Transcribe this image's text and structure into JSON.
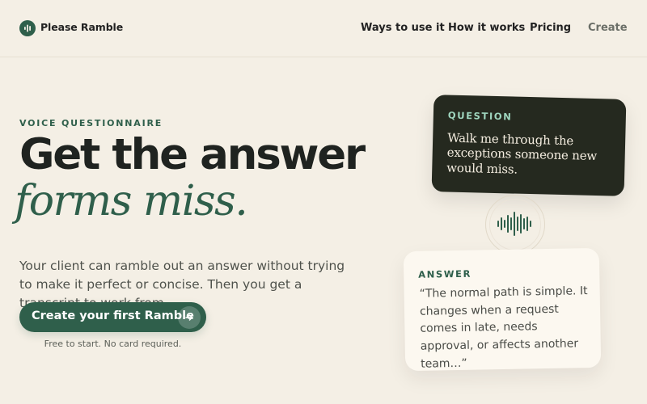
{
  "nav": {
    "brand": "Please Ramble",
    "links": [
      "Ways to use it",
      "How it works",
      "Pricing",
      "Create"
    ]
  },
  "hero": {
    "eyebrow": "VOICE QUESTIONNAIRE",
    "title": "Get the answer",
    "title_italic": "forms miss.",
    "description": "Your client can ramble out an answer without trying to make it perfect or concise. Then you get a transcript to work from.",
    "cta_label": "Create your first Ramble",
    "cta_note": "Free to start. No card required."
  },
  "question_card": {
    "label": "QUESTION",
    "text": "Walk me through the exceptions someone new would miss."
  },
  "answer_card": {
    "label": "ANSWER",
    "text": "“The normal path is simple. It changes when a request comes in late, needs approval, or affects another team…”"
  },
  "icons": {
    "brand": "waveform-icon",
    "cta": "arrow-right-icon",
    "voice": "audio-wave-icon"
  },
  "colors": {
    "background": "#f4efe5",
    "accent": "#2f5f4b",
    "question_card": "#25291f",
    "answer_card": "#fcf8f0"
  }
}
